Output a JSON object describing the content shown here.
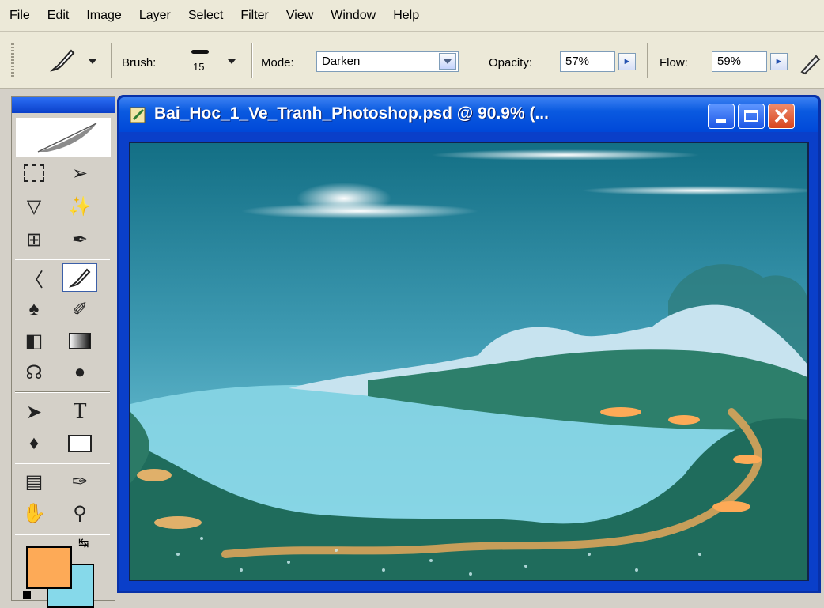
{
  "menu": [
    "File",
    "Edit",
    "Image",
    "Layer",
    "Select",
    "Filter",
    "View",
    "Window",
    "Help"
  ],
  "options": {
    "brush_label": "Brush:",
    "brush_size": "15",
    "mode_label": "Mode:",
    "mode_value": "Darken",
    "opacity_label": "Opacity:",
    "opacity_value": "57%",
    "flow_label": "Flow:",
    "flow_value": "59%"
  },
  "document": {
    "title": "Bai_Hoc_1_Ve_Tranh_Photoshop.psd @ 90.9% (..."
  },
  "tools": {
    "text_tool_glyph": "T"
  },
  "colors": {
    "foreground": "#fdaa57",
    "background": "#86d9ea",
    "title_bar": "#0a5ae0"
  }
}
